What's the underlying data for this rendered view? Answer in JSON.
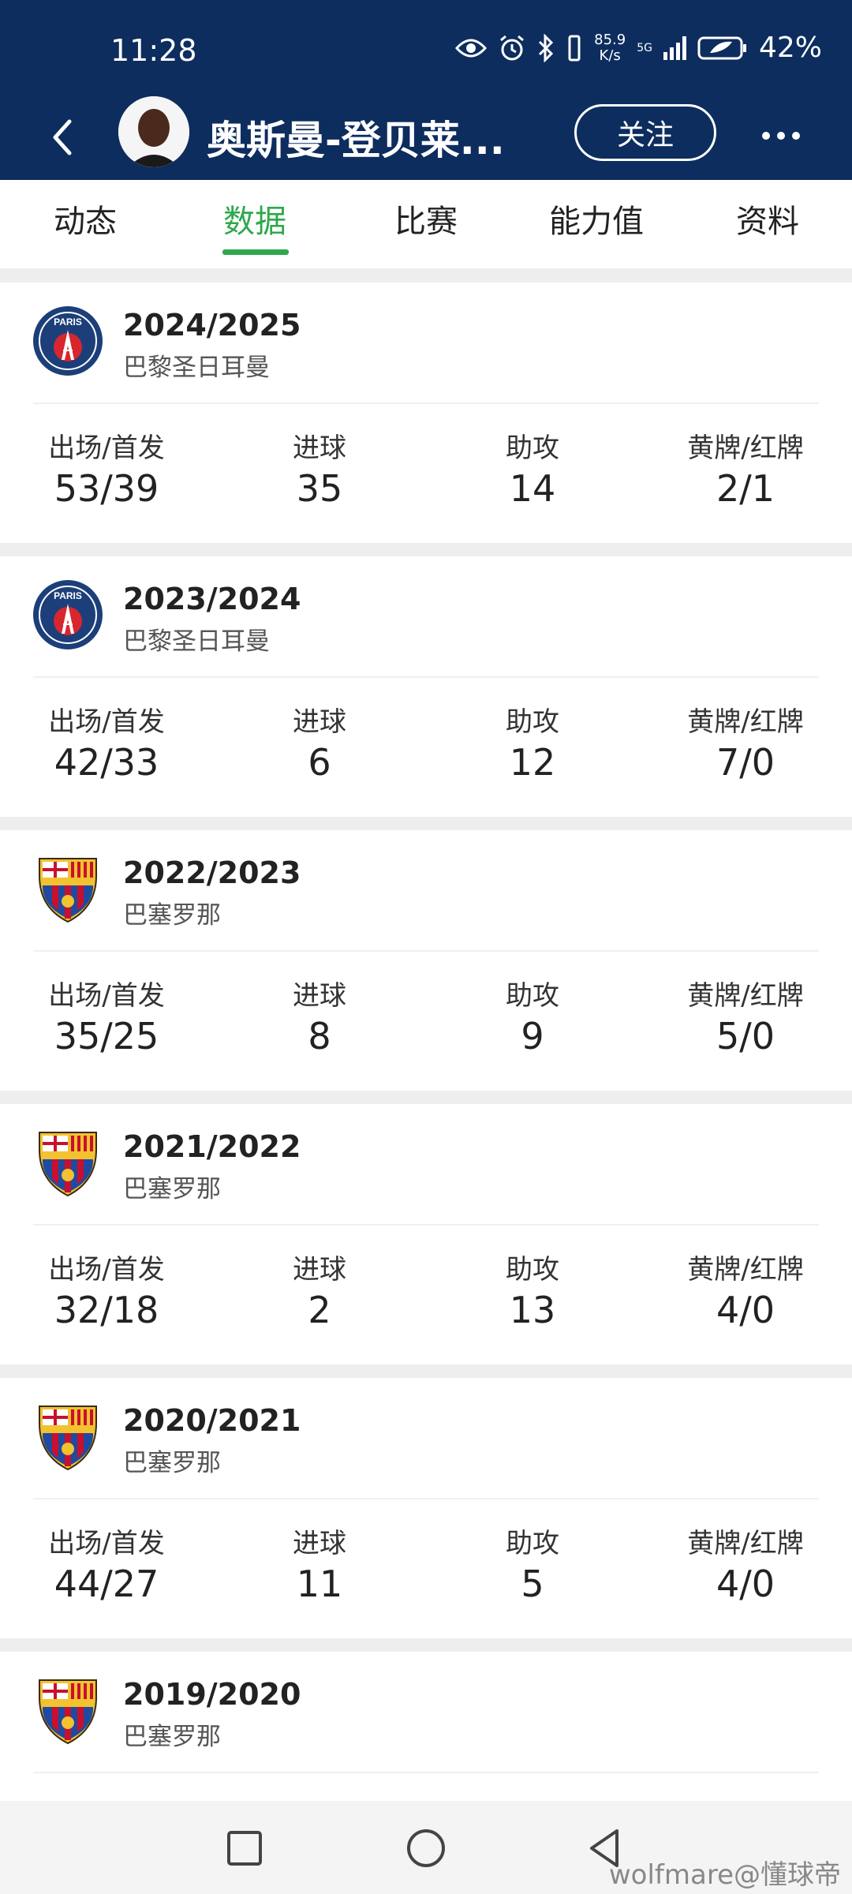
{
  "status_bar": {
    "time": "11:28",
    "net_speed_value": "85.9",
    "net_speed_unit": "K/s",
    "signal_label": "5G",
    "battery": "42%",
    "icons": [
      "eye-icon",
      "alarm-icon",
      "bluetooth-icon",
      "vibrate-icon",
      "signal-icon",
      "battery-icon"
    ]
  },
  "header": {
    "player_name": "奥斯曼-登贝莱...",
    "follow_label": "关注"
  },
  "tabs": [
    {
      "label": "动态",
      "active": false
    },
    {
      "label": "数据",
      "active": true
    },
    {
      "label": "比赛",
      "active": false
    },
    {
      "label": "能力值",
      "active": false
    },
    {
      "label": "资料",
      "active": false
    }
  ],
  "stat_labels": {
    "apps": "出场/首发",
    "goals": "进球",
    "assists": "助攻",
    "cards": "黄牌/红牌"
  },
  "seasons": [
    {
      "season": "2024/2025",
      "club": "巴黎圣日耳曼",
      "club_logo": "psg",
      "apps": "53/39",
      "goals": "35",
      "assists": "14",
      "cards": "2/1"
    },
    {
      "season": "2023/2024",
      "club": "巴黎圣日耳曼",
      "club_logo": "psg",
      "apps": "42/33",
      "goals": "6",
      "assists": "12",
      "cards": "7/0"
    },
    {
      "season": "2022/2023",
      "club": "巴塞罗那",
      "club_logo": "fcb",
      "apps": "35/25",
      "goals": "8",
      "assists": "9",
      "cards": "5/0"
    },
    {
      "season": "2021/2022",
      "club": "巴塞罗那",
      "club_logo": "fcb",
      "apps": "32/18",
      "goals": "2",
      "assists": "13",
      "cards": "4/0"
    },
    {
      "season": "2020/2021",
      "club": "巴塞罗那",
      "club_logo": "fcb",
      "apps": "44/27",
      "goals": "11",
      "assists": "5",
      "cards": "4/0"
    },
    {
      "season": "2019/2020",
      "club": "巴塞罗那",
      "club_logo": "fcb"
    }
  ],
  "colors": {
    "header_bg": "#0d2d5e",
    "accent_green": "#2ea84b",
    "psg_blue": "#1c3f7a",
    "psg_red": "#d8262e",
    "fcb_red": "#c8102e",
    "fcb_blue": "#1f4aa0",
    "fcb_gold": "#f2c230"
  },
  "watermark": "wolfmare@懂球帝"
}
